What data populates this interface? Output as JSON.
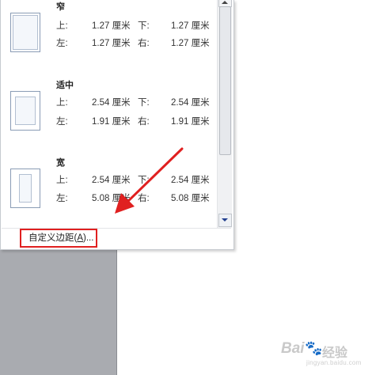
{
  "margins_menu": {
    "presets": [
      {
        "name": "窄",
        "top_label": "上:",
        "top": "1.27 厘米",
        "bottom_label": "下:",
        "bottom": "1.27 厘米",
        "left_label": "左:",
        "left": "1.27 厘米",
        "right_label": "右:",
        "right": "1.27 厘米"
      },
      {
        "name": "适中",
        "top_label": "上:",
        "top": "2.54 厘米",
        "bottom_label": "下:",
        "bottom": "2.54 厘米",
        "left_label": "左:",
        "left": "1.91 厘米",
        "right_label": "右:",
        "right": "1.91 厘米"
      },
      {
        "name": "宽",
        "top_label": "上:",
        "top": "2.54 厘米",
        "bottom_label": "下:",
        "bottom": "2.54 厘米",
        "left_label": "左:",
        "left": "5.08 厘米",
        "right_label": "右:",
        "right": "5.08 厘米"
      }
    ],
    "custom_margins": {
      "text_before": "自定义边距(",
      "accelerator": "A",
      "text_after": ")..."
    }
  },
  "colors": {
    "highlight": "#e02020",
    "annotation_arrow": "#e02020",
    "scroll_arrow": "#23408f"
  },
  "icons": [
    "page-margin-narrow-icon",
    "page-margin-normal-icon",
    "page-margin-wide-icon",
    "scroll-up-icon",
    "scroll-down-icon",
    "red-arrow-annotation",
    "baidu-watermark"
  ],
  "watermark": {
    "text": "Bai",
    "paw": "🐾",
    "suffix": "经验",
    "sub": "jingyan.baidu.com"
  }
}
